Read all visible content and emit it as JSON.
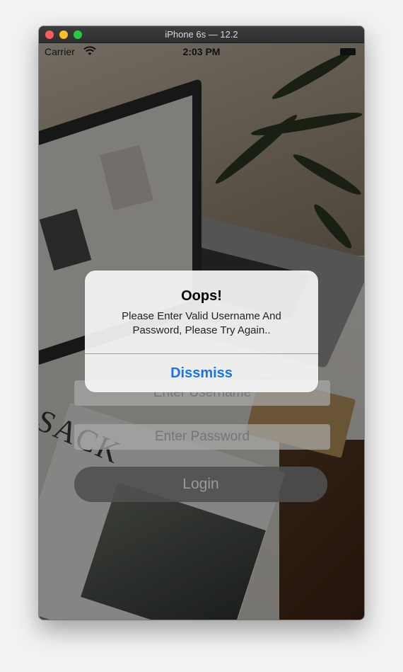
{
  "window": {
    "title": "iPhone 6s — 12.2"
  },
  "status_bar": {
    "carrier": "Carrier",
    "time": "2:03 PM"
  },
  "background": {
    "magazine_text": "SACK"
  },
  "form": {
    "username_placeholder": "Enter Username",
    "password_placeholder": "Enter Password",
    "login_label": "Login"
  },
  "alert": {
    "title": "Oops!",
    "message": "Please Enter Valid Username And Password, Please Try Again..",
    "button_label": "Dissmiss",
    "button_color": "#1a73e8"
  },
  "icons": {
    "wifi": "wifi-icon",
    "battery": "battery-icon"
  }
}
